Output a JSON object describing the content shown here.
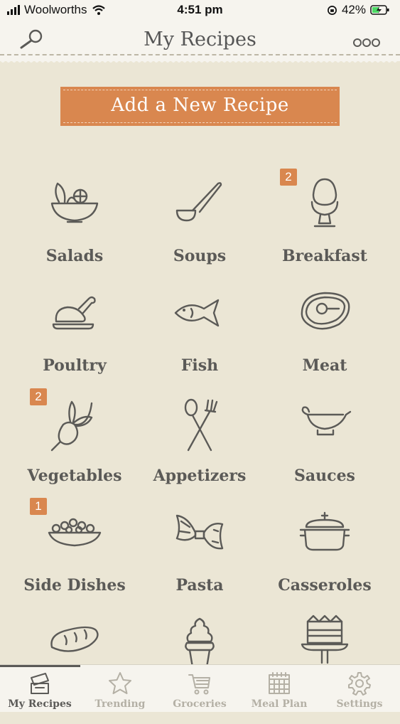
{
  "status": {
    "carrier": "Woolworths",
    "time": "4:51 pm",
    "battery": "42%"
  },
  "header": {
    "title": "My Recipes",
    "search_icon": "search-icon",
    "more_icon": "more-icon"
  },
  "add_button": {
    "label": "Add a New Recipe"
  },
  "categories": [
    {
      "label": "Salads",
      "icon": "salad-bowl-icon",
      "badge": ""
    },
    {
      "label": "Soups",
      "icon": "ladle-icon",
      "badge": ""
    },
    {
      "label": "Breakfast",
      "icon": "egg-cup-icon",
      "badge": "2"
    },
    {
      "label": "Poultry",
      "icon": "chicken-icon",
      "badge": ""
    },
    {
      "label": "Fish",
      "icon": "fish-icon",
      "badge": ""
    },
    {
      "label": "Meat",
      "icon": "steak-icon",
      "badge": ""
    },
    {
      "label": "Vegetables",
      "icon": "beet-icon",
      "badge": "2"
    },
    {
      "label": "Appetizers",
      "icon": "spoon-fork-icon",
      "badge": ""
    },
    {
      "label": "Sauces",
      "icon": "gravy-boat-icon",
      "badge": ""
    },
    {
      "label": "Side Dishes",
      "icon": "side-dish-icon",
      "badge": "1"
    },
    {
      "label": "Pasta",
      "icon": "farfalle-icon",
      "badge": ""
    },
    {
      "label": "Casseroles",
      "icon": "casserole-pot-icon",
      "badge": ""
    },
    {
      "label": "",
      "icon": "bread-icon",
      "badge": ""
    },
    {
      "label": "",
      "icon": "cupcake-icon",
      "badge": ""
    },
    {
      "label": "",
      "icon": "cake-stand-icon",
      "badge": ""
    }
  ],
  "tabs": [
    {
      "label": "My Recipes",
      "icon": "recipe-box-icon",
      "active": true
    },
    {
      "label": "Trending",
      "icon": "star-icon",
      "active": false
    },
    {
      "label": "Groceries",
      "icon": "cart-icon",
      "active": false
    },
    {
      "label": "Meal Plan",
      "icon": "calendar-icon",
      "active": false
    },
    {
      "label": "Settings",
      "icon": "gear-icon",
      "active": false
    }
  ],
  "colors": {
    "accent": "#d9874f",
    "background": "#ebe6d5",
    "icon": "#5b5a57",
    "inactive": "#b4b0a5"
  }
}
